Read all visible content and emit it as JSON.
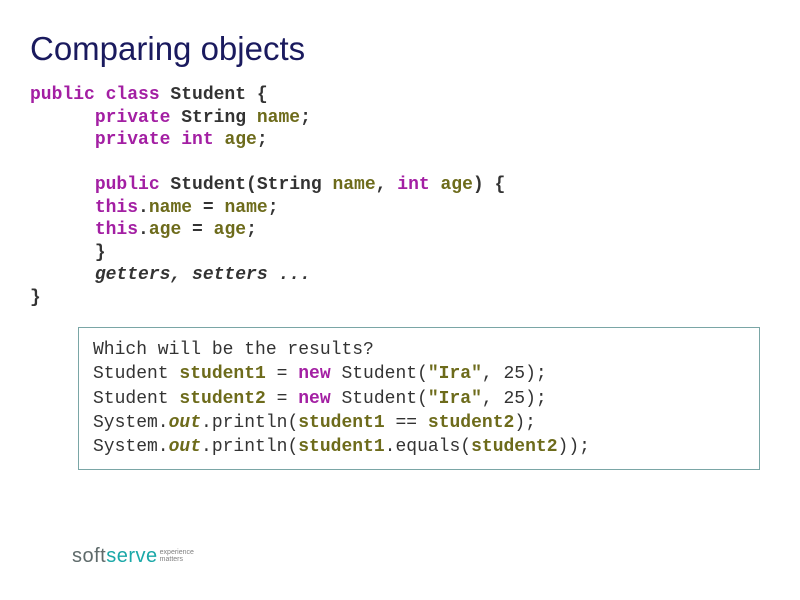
{
  "title": "Comparing objects",
  "code": {
    "l1a": "public class",
    "l1b": " Student {",
    "l2a": "private",
    "l2b": " String ",
    "l2c": "name",
    "l2d": ";",
    "l3a": "private int ",
    "l3b": "age",
    "l3c": ";",
    "blank": "",
    "l4a": "public",
    "l4b": " Student(String ",
    "l4c": "name",
    "l4d": ", ",
    "l4e": "int ",
    "l4f": "age",
    "l4g": ") {",
    "l5a": "this",
    "l5b": ".",
    "l5c": "name",
    "l5d": " = ",
    "l5e": "name",
    "l5f": ";",
    "l6a": "this",
    "l6b": ".",
    "l6c": "age",
    "l6d": " = ",
    "l6e": "age",
    "l6f": ";",
    "l7": "}",
    "l8": "getters, setters ...",
    "l9": "}"
  },
  "box": {
    "q": "Which will be the results?",
    "b1a": "Student ",
    "b1b": "student1",
    "b1c": " = ",
    "b1d": "new",
    "b1e": " Student(",
    "b1f": "\"Ira\"",
    "b1g": ", 25);",
    "b2a": "Student ",
    "b2b": "student2",
    "b2c": " = ",
    "b2d": "new",
    "b2e": " Student(",
    "b2f": "\"Ira\"",
    "b2g": ", 25);",
    "b3a": "System.",
    "b3b": "out",
    "b3c": ".println(",
    "b3d": "student1",
    "b3e": " == ",
    "b3f": "student2",
    "b3g": ");",
    "b4a": "System.",
    "b4b": "out",
    "b4c": ".println(",
    "b4d": "student1",
    "b4e": ".equals(",
    "b4f": "student2",
    "b4g": "));"
  },
  "footer": {
    "soft": "soft",
    "serve": "serve",
    "tag1": "experience",
    "tag2": "matters"
  }
}
